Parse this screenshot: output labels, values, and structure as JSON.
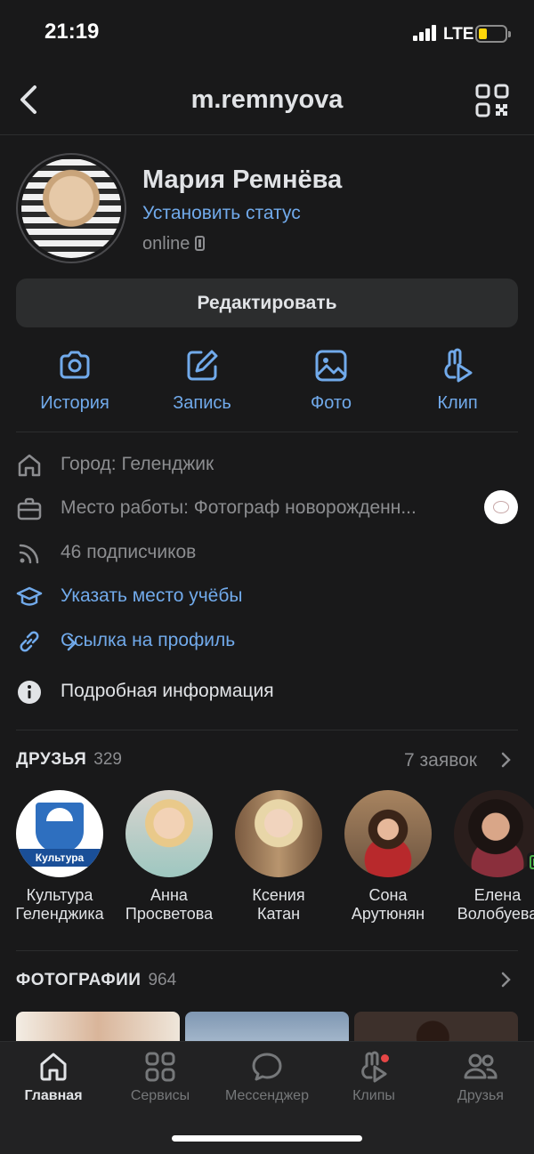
{
  "status_bar": {
    "time": "21:19",
    "network": "LTE",
    "battery_color": "#ffd60a"
  },
  "header": {
    "handle": "m.remnyova"
  },
  "profile": {
    "name": "Мария Ремнёва",
    "status_link": "Установить статус",
    "online": "online",
    "edit_button": "Редактировать"
  },
  "actions": [
    {
      "label": "История",
      "icon": "camera-icon"
    },
    {
      "label": "Запись",
      "icon": "edit-icon"
    },
    {
      "label": "Фото",
      "icon": "image-icon"
    },
    {
      "label": "Клип",
      "icon": "clip-icon"
    }
  ],
  "info": {
    "city": "Город: Геленджик",
    "work": "Место работы: Фотограф новорожденн...",
    "followers": "46 подписчиков",
    "education": "Указать место учёбы",
    "profile_link": "Ссылка на профиль",
    "details": "Подробная информация"
  },
  "friends": {
    "title": "ДРУЗЬЯ",
    "count": "329",
    "requests": "7 заявок",
    "items": [
      {
        "line1": "Культура",
        "line2": "Геленджика",
        "avatar_text": "Культура"
      },
      {
        "line1": "Анна",
        "line2": "Просветова"
      },
      {
        "line1": "Ксения",
        "line2": "Катан"
      },
      {
        "line1": "Сона",
        "line2": "Арутюнян"
      },
      {
        "line1": "Елена",
        "line2": "Волобуева"
      }
    ]
  },
  "photos": {
    "title": "ФОТОГРАФИИ",
    "count": "964"
  },
  "tabbar": [
    {
      "label": "Главная",
      "icon": "home-icon",
      "active": true
    },
    {
      "label": "Сервисы",
      "icon": "services-icon"
    },
    {
      "label": "Мессенджер",
      "icon": "messenger-icon"
    },
    {
      "label": "Клипы",
      "icon": "clips-icon",
      "badge": true
    },
    {
      "label": "Друзья",
      "icon": "friends-icon"
    }
  ],
  "colors": {
    "accent": "#71aaeb",
    "background": "#19191a",
    "secondary_text": "#8c8d90"
  }
}
